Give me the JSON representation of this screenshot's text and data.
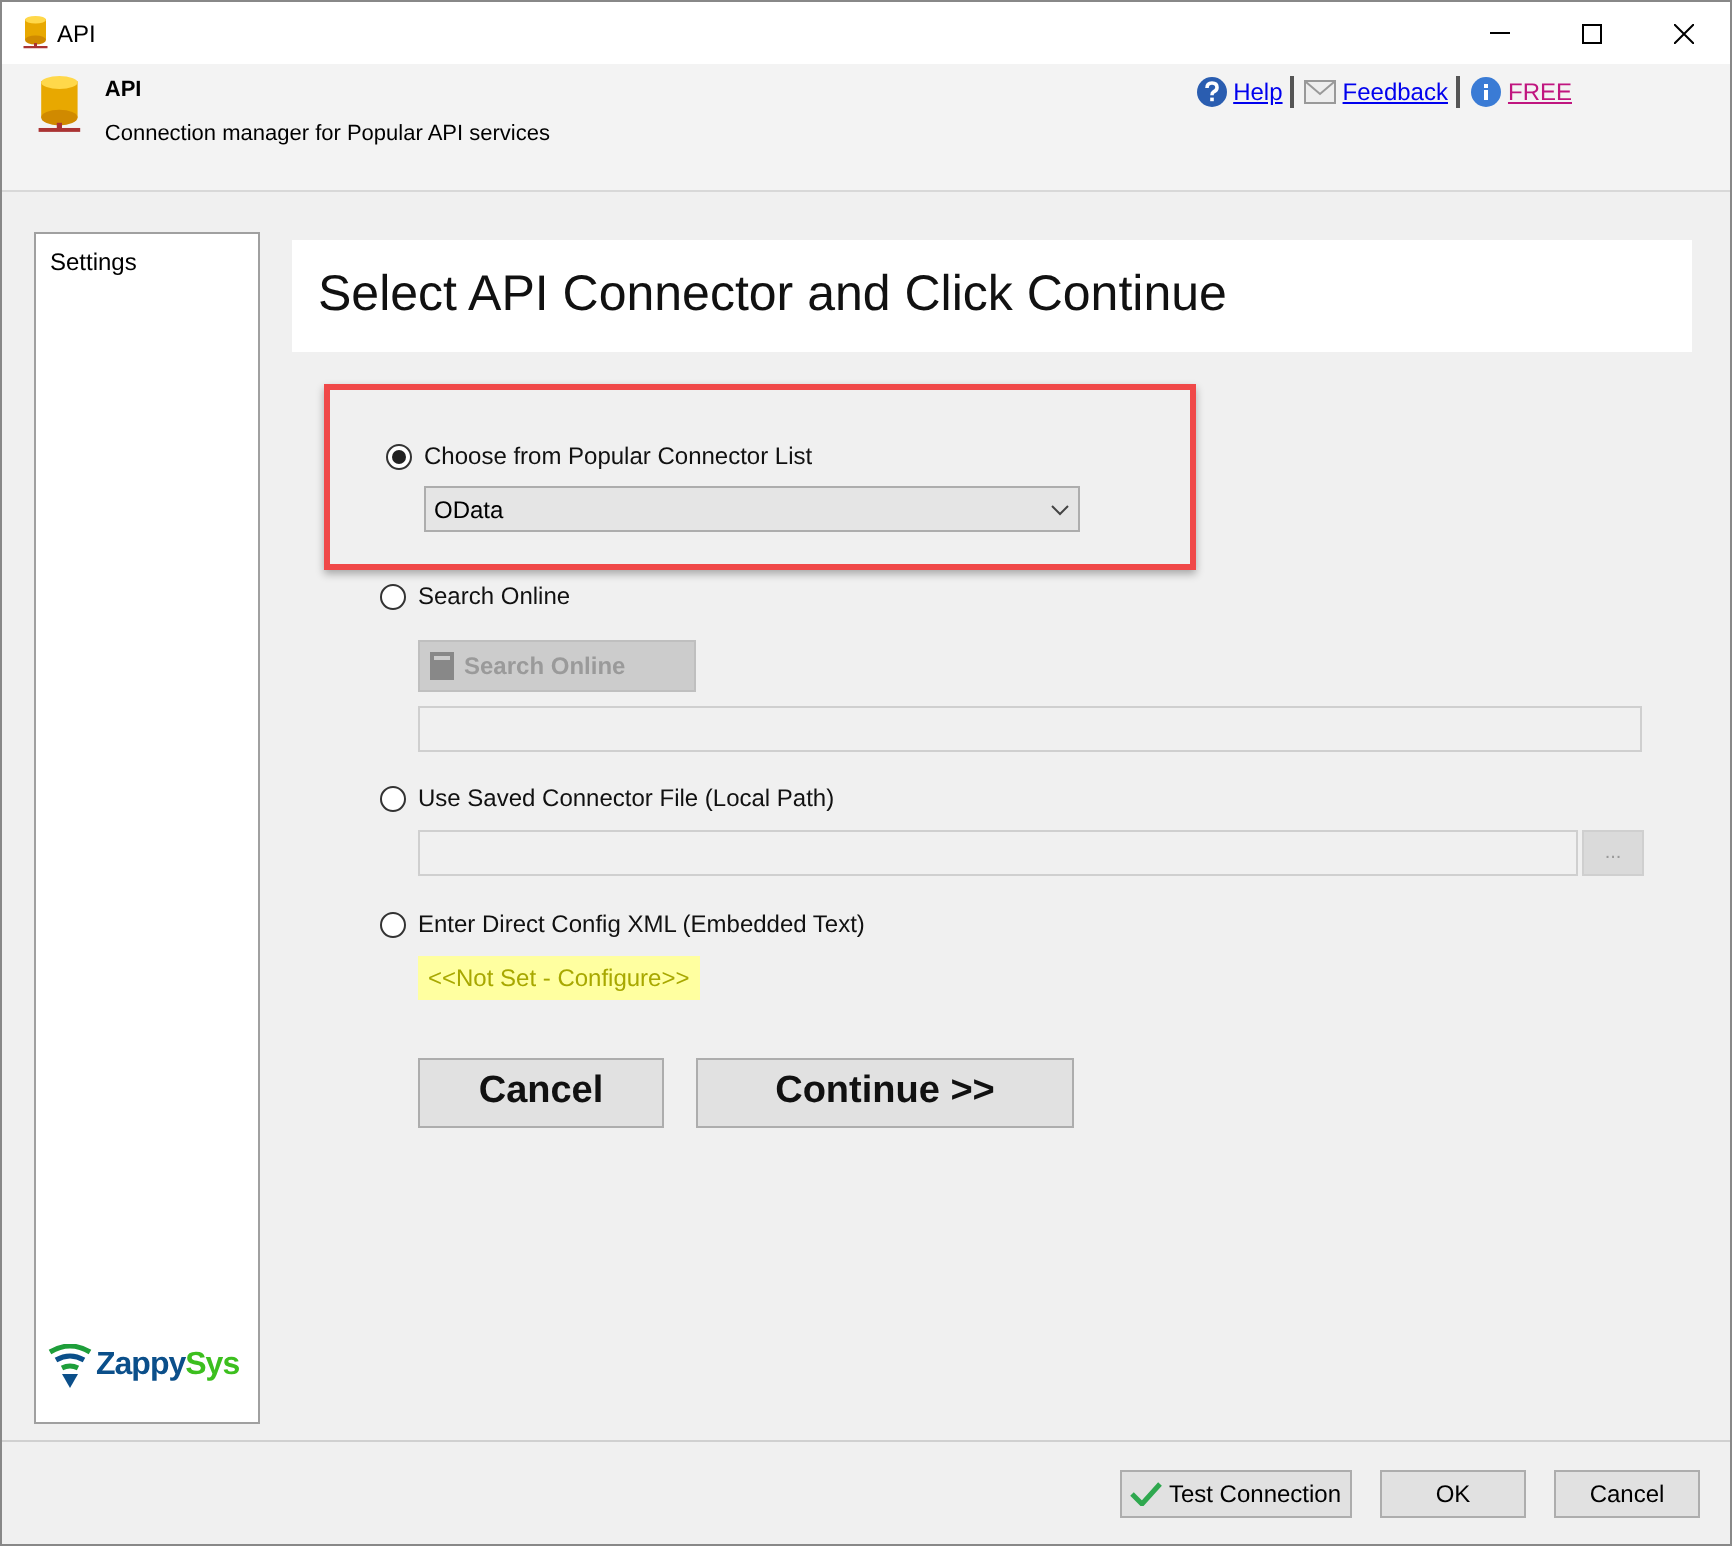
{
  "window": {
    "title": "API"
  },
  "header": {
    "title": "API",
    "subtitle": "Connection manager for Popular API services",
    "links": [
      {
        "kind": "help",
        "label": "Help"
      },
      {
        "kind": "feedback",
        "label": "Feedback"
      },
      {
        "kind": "info",
        "label": "FREE"
      }
    ]
  },
  "sidebar": {
    "items": [
      {
        "label": "Settings",
        "selected": false
      }
    ],
    "logo": {
      "first": "Zappy",
      "second": "Sys"
    }
  },
  "heading": "Select API Connector and Click Continue",
  "options": [
    {
      "kind": "dropdown",
      "label": "Choose from Popular Connector List",
      "selected": true,
      "value": "OData",
      "highlighted": true
    },
    {
      "kind": "search",
      "label": "Search Online",
      "selected": false,
      "button": {
        "label": "Search Online",
        "disabled": true
      }
    },
    {
      "kind": "file",
      "label": "Use Saved Connector File (Local Path)",
      "selected": false,
      "browse": "..."
    },
    {
      "kind": "xml",
      "label": "Enter Direct Config XML (Embedded Text)",
      "selected": false,
      "value": "<<Not Set - Configure>>"
    }
  ],
  "actions": [
    "Cancel",
    "Continue >>"
  ],
  "footer": {
    "buttons": [
      {
        "kind": "test",
        "label": "Test Connection"
      },
      {
        "kind": "plain",
        "label": "OK"
      },
      {
        "kind": "plain",
        "label": "Cancel"
      }
    ]
  }
}
